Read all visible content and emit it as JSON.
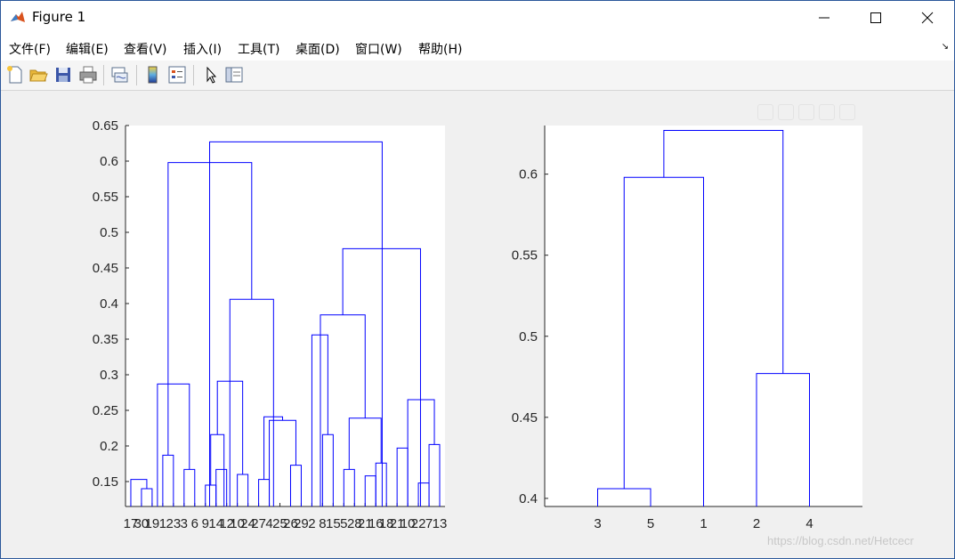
{
  "window": {
    "title": "Figure 1",
    "app_icon": "matlab-icon"
  },
  "menu": [
    {
      "label": "文件(F)"
    },
    {
      "label": "编辑(E)"
    },
    {
      "label": "查看(V)"
    },
    {
      "label": "插入(I)"
    },
    {
      "label": "工具(T)"
    },
    {
      "label": "桌面(D)"
    },
    {
      "label": "窗口(W)"
    },
    {
      "label": "帮助(H)"
    }
  ],
  "toolbar": [
    {
      "icon": "new-figure-icon"
    },
    {
      "icon": "open-file-icon"
    },
    {
      "icon": "save-icon"
    },
    {
      "icon": "print-icon"
    },
    {
      "icon": "link-plot-icon"
    },
    {
      "icon": "colorbar-icon"
    },
    {
      "icon": "legend-icon"
    },
    {
      "icon": "pointer-icon"
    },
    {
      "icon": "property-editor-icon"
    }
  ],
  "colors": {
    "dendrogram_line": "#0000ff",
    "axis": "#262626"
  },
  "chart_data": [
    {
      "type": "dendrogram",
      "ylim": [
        0.115,
        0.65
      ],
      "yticks": [
        0.15,
        0.2,
        0.25,
        0.3,
        0.35,
        0.4,
        0.45,
        0.5,
        0.55,
        0.6,
        0.65
      ],
      "ytick_labels": [
        "0.15",
        "0.2",
        "0.25",
        "0.3",
        "0.35",
        "0.4",
        "0.45",
        "0.5",
        "0.55",
        "0.6",
        "0.65"
      ],
      "leaf_labels": [
        "17",
        "30",
        "19",
        "1",
        "23",
        "3",
        "6",
        "9",
        "14",
        "12",
        "10",
        "24",
        "27",
        "4",
        "25",
        "26",
        "29",
        "2",
        "8",
        "15",
        "5",
        "28",
        "21",
        "16",
        "18",
        "21",
        "10",
        "22",
        "7",
        "13"
      ],
      "links": [
        [
          1,
          2,
          0.14
        ],
        [
          3,
          4,
          0.187
        ],
        [
          0,
          1.5,
          0.153
        ],
        [
          5,
          6,
          0.167
        ],
        [
          7,
          8,
          0.145
        ],
        [
          8,
          9,
          0.167
        ],
        [
          10,
          11,
          0.16
        ],
        [
          7.5,
          8.75,
          0.216
        ],
        [
          8.125,
          10.5,
          0.291
        ],
        [
          12,
          13,
          0.153
        ],
        [
          15,
          16,
          0.173
        ],
        [
          13,
          15.5,
          0.236
        ],
        [
          12.5,
          14.25,
          0.241
        ],
        [
          9.3,
          13.4,
          0.406
        ],
        [
          2.5,
          5.5,
          0.287
        ],
        [
          3.5,
          11.35,
          0.598
        ],
        [
          18,
          19,
          0.216
        ],
        [
          17,
          18.5,
          0.356
        ],
        [
          20,
          21,
          0.167
        ],
        [
          22,
          23,
          0.158
        ],
        [
          23,
          24,
          0.176
        ],
        [
          20.5,
          23.5,
          0.239
        ],
        [
          17.8,
          22,
          0.384
        ],
        [
          25,
          26,
          0.197
        ],
        [
          27,
          28,
          0.148
        ],
        [
          28,
          29,
          0.202
        ],
        [
          26,
          28.5,
          0.265
        ],
        [
          19.9,
          27.2,
          0.477
        ],
        [
          7.4,
          23.6,
          0.627
        ]
      ]
    },
    {
      "type": "dendrogram",
      "ylim": [
        0.395,
        0.63
      ],
      "yticks": [
        0.4,
        0.45,
        0.5,
        0.55,
        0.6
      ],
      "ytick_labels": [
        "0.4",
        "0.45",
        "0.5",
        "0.55",
        "0.6"
      ],
      "leaf_labels": [
        "3",
        "5",
        "1",
        "2",
        "4"
      ],
      "links": [
        [
          1,
          2,
          0.406
        ],
        [
          1.5,
          3,
          0.598
        ],
        [
          4,
          5,
          0.477
        ],
        [
          2.25,
          4.5,
          0.627
        ]
      ],
      "xlim": [
        0,
        6
      ]
    }
  ],
  "watermark": "https://blog.csdn.net/Hetcecr"
}
